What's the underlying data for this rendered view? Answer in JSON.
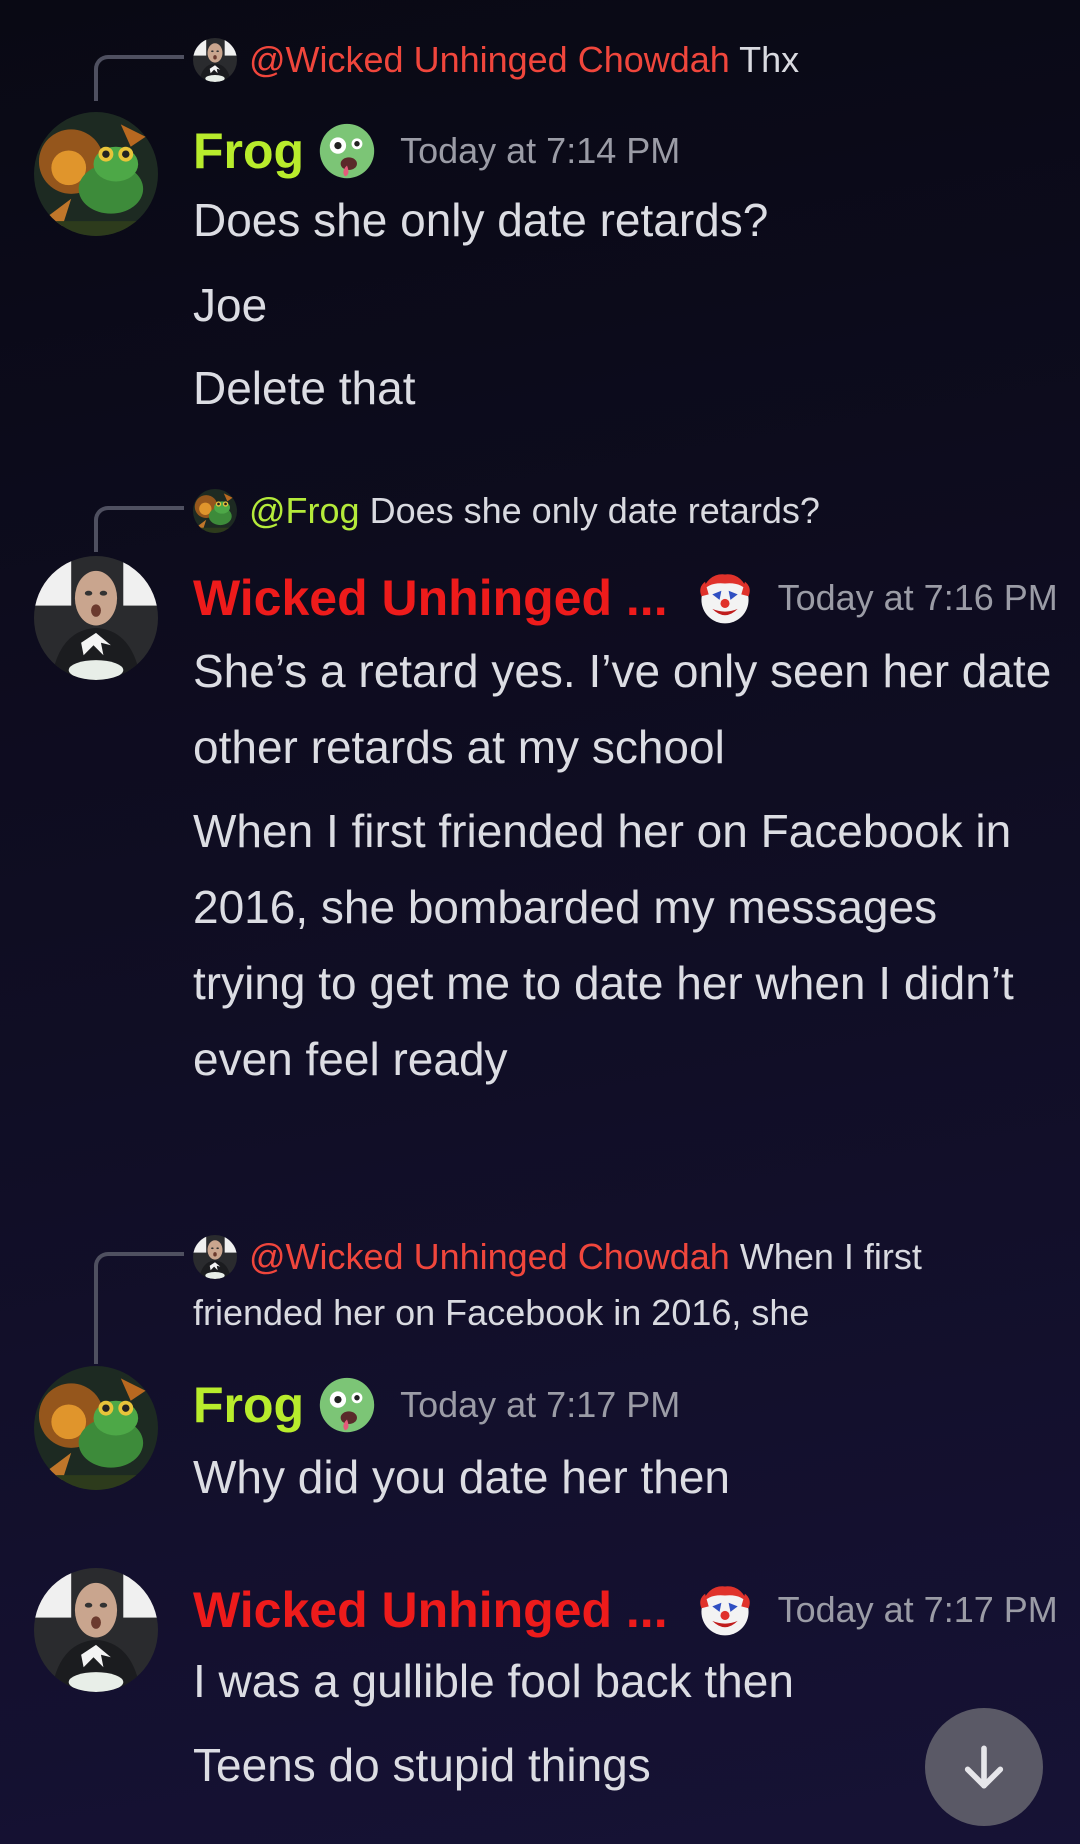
{
  "messages": [
    {
      "reply": {
        "mention": "@Wicked Unhinged Chowdah",
        "text": "Thx"
      },
      "author": "Frog",
      "time": "Today at 7:14 PM",
      "lines": [
        "Does she only date retards?",
        "Joe",
        "Delete that"
      ]
    },
    {
      "reply": {
        "mention": "@Frog",
        "text": "Does she only date retards?"
      },
      "author": "Wicked Unhinged ...",
      "time": "Today at 7:16 PM",
      "lines": [
        "She’s a retard yes. I’ve only seen her date other retards at my school",
        "When I first friended her on Facebook in 2016, she bombarded my messages trying to get me to date her when I didn’t even feel ready"
      ]
    },
    {
      "reply": {
        "mention": "@Wicked Unhinged Chowdah",
        "text": "When I first friended her on Facebook in 2016, she"
      },
      "author": "Frog",
      "time": "Today at 7:17 PM",
      "lines": [
        "Why did you date her then"
      ]
    },
    {
      "author": "Wicked Unhinged ...",
      "time": "Today at 7:17 PM",
      "lines": [
        "I was a gullible fool back then",
        "Teens do stupid things"
      ]
    }
  ],
  "colors": {
    "frog_name": "#b8ec2c",
    "wicked_name": "#ee1b1b",
    "mention_red": "#f0463c",
    "mention_green": "#b4ea3a"
  },
  "icons": {
    "frog_status": "zombie-face-icon",
    "wicked_status": "clown-face-icon",
    "scroll": "arrow-down-icon"
  }
}
